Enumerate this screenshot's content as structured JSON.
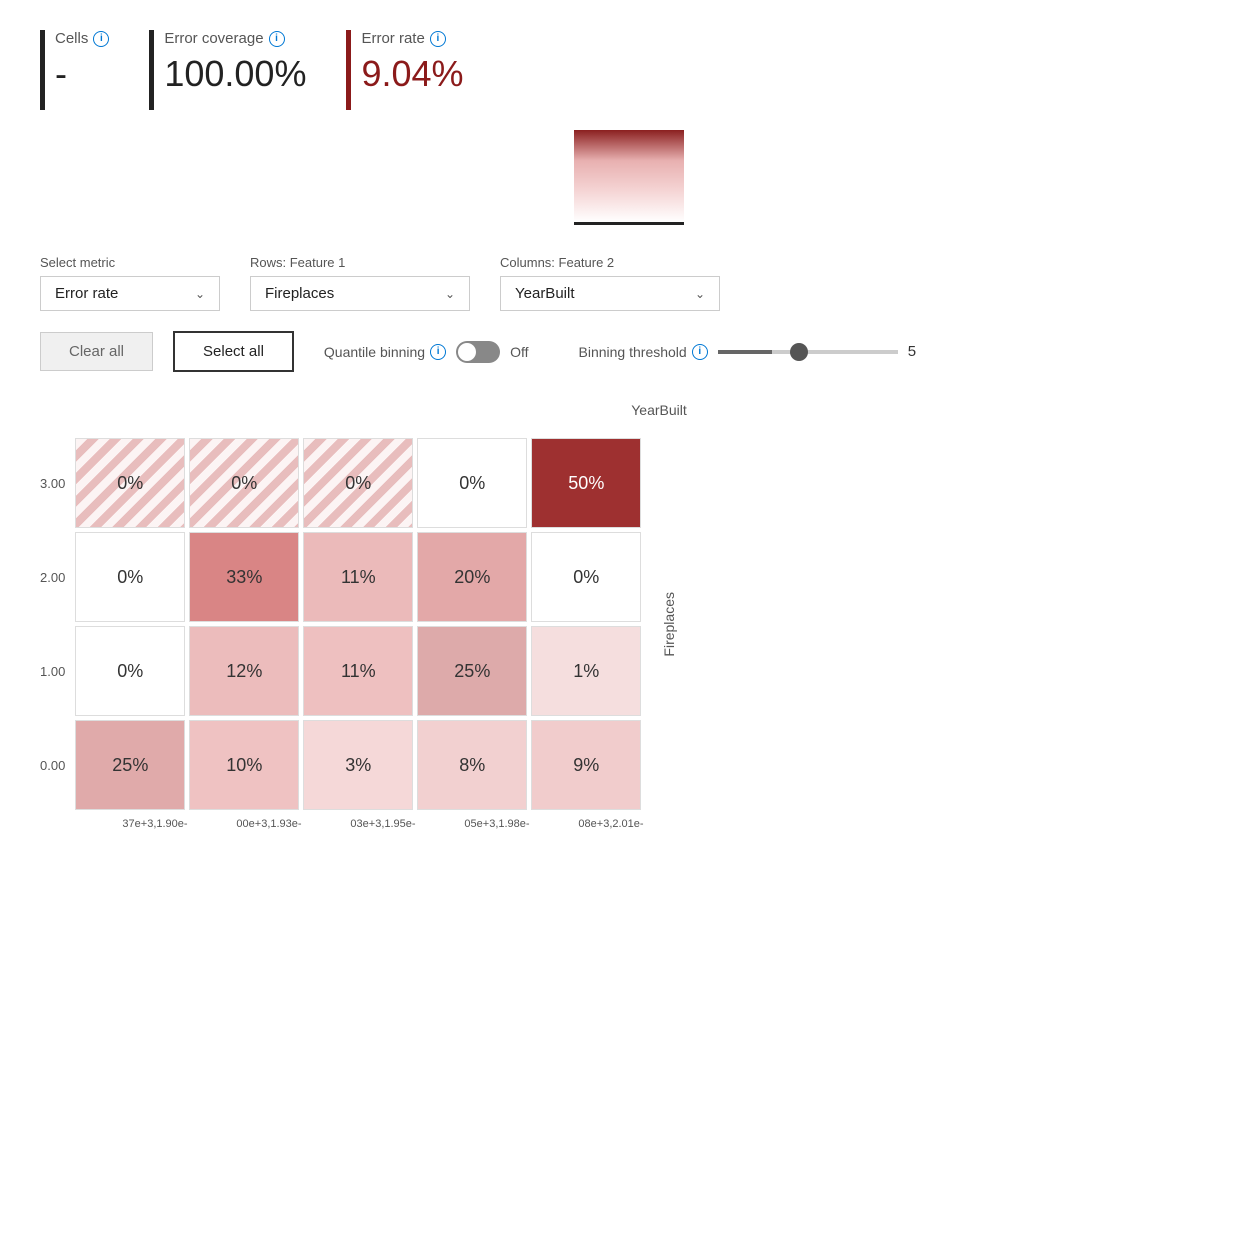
{
  "metrics": {
    "cells": {
      "label": "Cells",
      "value": "-",
      "isRed": false
    },
    "errorCoverage": {
      "label": "Error coverage",
      "value": "100.00%",
      "isRed": false
    },
    "errorRate": {
      "label": "Error rate",
      "value": "9.04%",
      "isRed": true
    }
  },
  "dropdowns": {
    "metric": {
      "label": "Select metric",
      "value": "Error rate"
    },
    "rows": {
      "label": "Rows: Feature 1",
      "value": "Fireplaces"
    },
    "columns": {
      "label": "Columns: Feature 2",
      "value": "YearBuilt"
    }
  },
  "buttons": {
    "clearAll": "Clear all",
    "selectAll": "Select all"
  },
  "quantileBinning": {
    "label": "Quantile binning",
    "state": "Off"
  },
  "binningThreshold": {
    "label": "Binning threshold",
    "value": "5"
  },
  "matrix": {
    "colAxisLabel": "YearBuilt",
    "rowAxisLabel": "Fireplaces",
    "rowLabels": [
      "3.00",
      "2.00",
      "1.00",
      "0.00"
    ],
    "xAxisLabels": [
      "37e+3,1.90e-",
      "00e+3,1.93e-",
      "03e+3,1.95e-",
      "05e+3,1.98e-",
      "08e+3,2.01e-"
    ],
    "rows": [
      {
        "rowLabel": "3.00",
        "cells": [
          {
            "value": "0%",
            "type": "hatched"
          },
          {
            "value": "0%",
            "type": "hatched"
          },
          {
            "value": "0%",
            "type": "hatched"
          },
          {
            "value": "0%",
            "type": "white"
          },
          {
            "value": "50%",
            "type": "dark-red"
          }
        ]
      },
      {
        "rowLabel": "2.00",
        "cells": [
          {
            "value": "0%",
            "type": "white"
          },
          {
            "value": "33%",
            "type": "medium-pink"
          },
          {
            "value": "11%",
            "type": "light-pink"
          },
          {
            "value": "20%",
            "type": "light-pink"
          },
          {
            "value": "0%",
            "type": "white"
          }
        ]
      },
      {
        "rowLabel": "1.00",
        "cells": [
          {
            "value": "0%",
            "type": "white"
          },
          {
            "value": "12%",
            "type": "light-pink"
          },
          {
            "value": "11%",
            "type": "light-pink"
          },
          {
            "value": "25%",
            "type": "medium-pink"
          },
          {
            "value": "1%",
            "type": "faint-pink"
          }
        ]
      },
      {
        "rowLabel": "0.00",
        "cells": [
          {
            "value": "25%",
            "type": "medium-pink"
          },
          {
            "value": "10%",
            "type": "light-pink"
          },
          {
            "value": "3%",
            "type": "faint-pink"
          },
          {
            "value": "8%",
            "type": "faint-pink"
          },
          {
            "value": "9%",
            "type": "faint-pink"
          }
        ]
      }
    ]
  }
}
